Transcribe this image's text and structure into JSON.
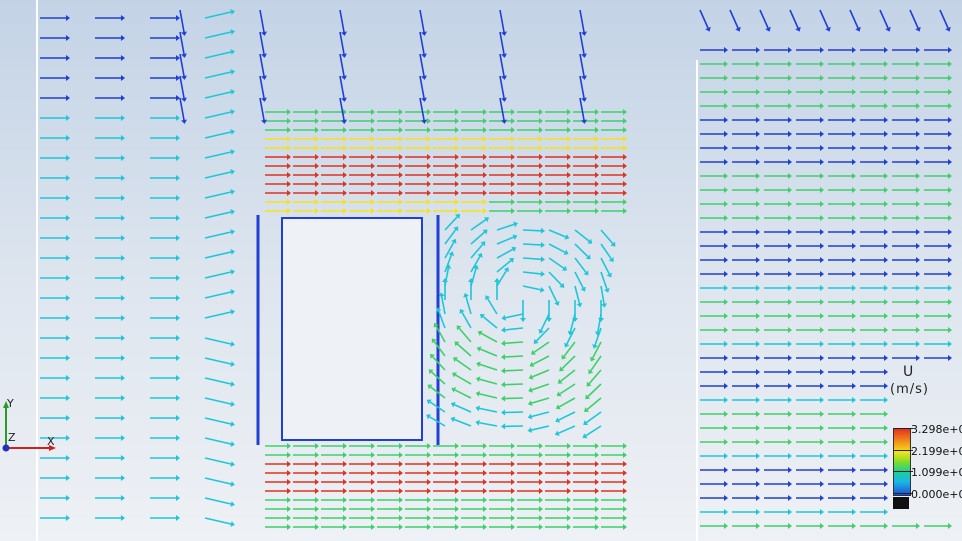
{
  "legend": {
    "title": "U",
    "units": "(m/s)",
    "ticks": [
      "3.298e+0",
      "2.199e+0",
      "1.099e+0",
      "0.000e+0"
    ]
  },
  "axes_triad": {
    "y": "Y",
    "z": "Z",
    "x": "X"
  },
  "colors": {
    "high": "#e0321e",
    "mid_high": "#f5e21a",
    "mid": "#3fd06a",
    "low_mid": "#1ec6d8",
    "low": "#1f3fd6"
  }
}
